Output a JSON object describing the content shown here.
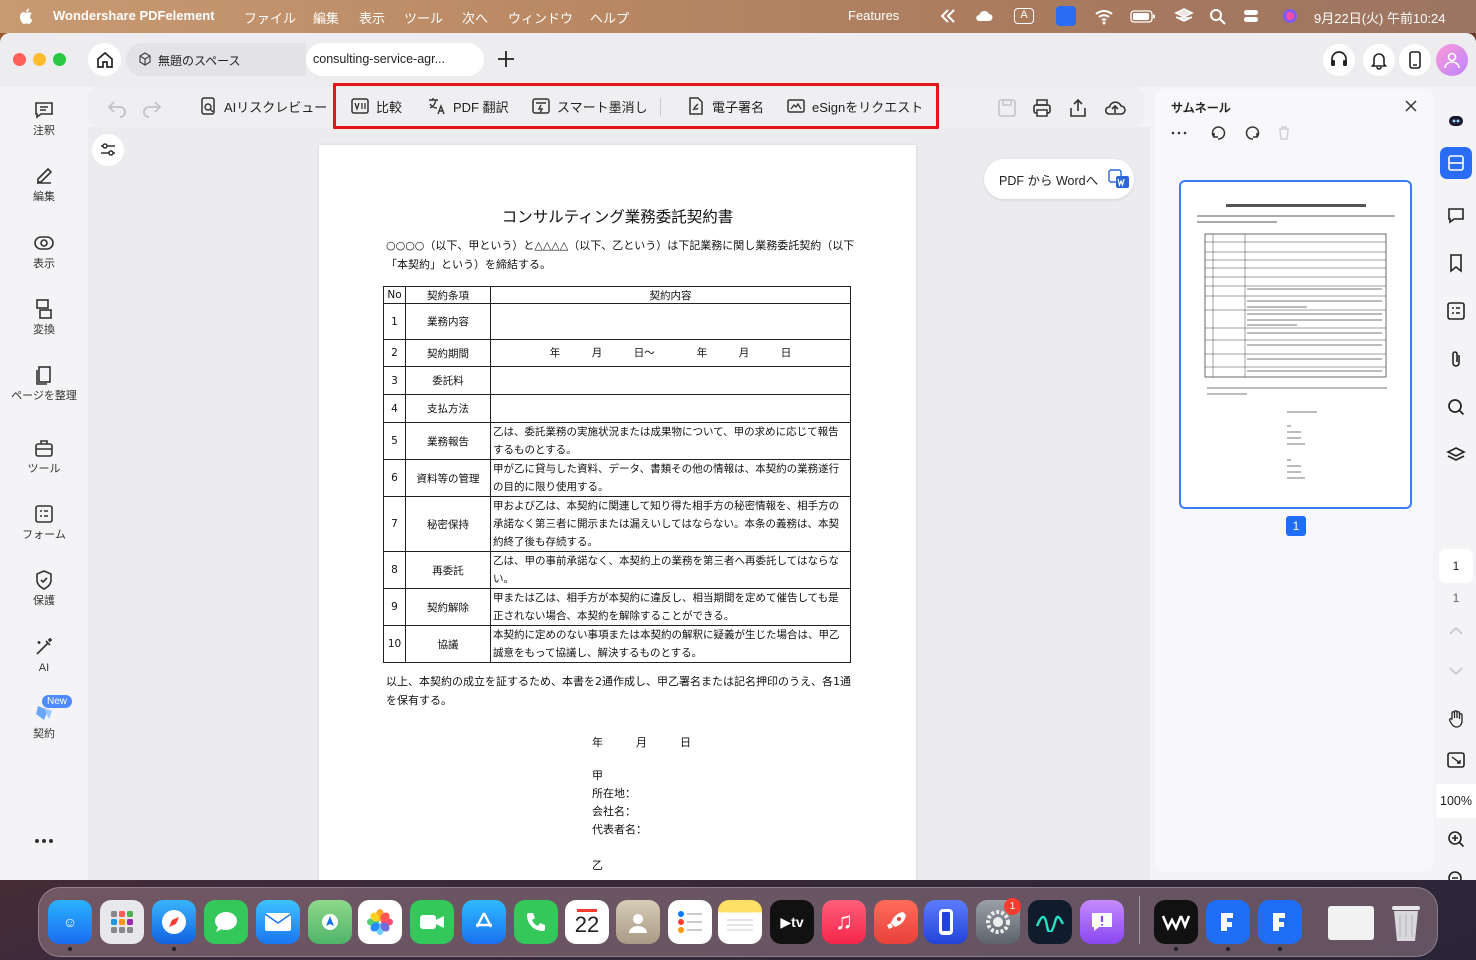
{
  "menubar": {
    "app_name": "Wondershare PDFelement",
    "menus": [
      "ファイル",
      "編集",
      "表示",
      "ツール",
      "次へ",
      "ウィンドウ",
      "ヘルプ"
    ],
    "features": "Features",
    "clock": "9月22日(火) 午前10:24",
    "input_indicator": "A"
  },
  "tabs": {
    "space": "無題のスペース",
    "document": "consulting-service-agr..."
  },
  "leftnav": [
    {
      "label": "注釈",
      "icon": "comment-icon"
    },
    {
      "label": "編集",
      "icon": "edit-icon"
    },
    {
      "label": "表示",
      "icon": "view-icon"
    },
    {
      "label": "変換",
      "icon": "convert-icon"
    },
    {
      "label": "ページを整理",
      "icon": "organize-pages-icon"
    },
    {
      "label": "ツール",
      "icon": "tools-icon"
    },
    {
      "label": "フォーム",
      "icon": "form-icon"
    },
    {
      "label": "保護",
      "icon": "protect-icon"
    },
    {
      "label": "AI",
      "icon": "ai-icon"
    },
    {
      "label": "契約",
      "icon": "contract-icon",
      "badge": "New"
    }
  ],
  "toolbar": {
    "ai_risk": "AIリスクレビュー",
    "compare": "比較",
    "translate": "PDF 翻訳",
    "redact": "スマート墨消し",
    "esign": "電子署名",
    "esign_request": "eSignをリクエスト"
  },
  "pdf_to_word": "PDF から Wordへ",
  "document": {
    "title": "コンサルティング業務委託契約書",
    "intro": "○○○○（以下、甲という）と△△△△（以下、乙という）は下記業務に関し業務委託契約（以下「本契約」という）を締結する。",
    "headers": [
      "No",
      "契約条項",
      "契約内容"
    ],
    "rows": [
      {
        "no": "1",
        "term": "業務内容",
        "content": ""
      },
      {
        "no": "2",
        "term": "契約期間",
        "content": "年　　　月　　　日〜　　　　年　　　月　　　日"
      },
      {
        "no": "3",
        "term": "委託料",
        "content": ""
      },
      {
        "no": "4",
        "term": "支払方法",
        "content": ""
      },
      {
        "no": "5",
        "term": "業務報告",
        "content": "乙は、委託業務の実施状況または成果物について、甲の求めに応じて報告するものとする。"
      },
      {
        "no": "6",
        "term": "資料等の管理",
        "content": "甲が乙に貸与した資料、データ、書類その他の情報は、本契約の業務遂行の目的に限り使用する。"
      },
      {
        "no": "7",
        "term": "秘密保持",
        "content": "甲および乙は、本契約に関連して知り得た相手方の秘密情報を、相手方の承諾なく第三者に開示または漏えいしてはならない。本条の義務は、本契約終了後も存続する。"
      },
      {
        "no": "8",
        "term": "再委託",
        "content": "乙は、甲の事前承諾なく、本契約上の業務を第三者へ再委託してはならない。"
      },
      {
        "no": "9",
        "term": "契約解除",
        "content": "甲または乙は、相手方が本契約に違反し、相当期間を定めて催告しても是正されない場合、本契約を解除することができる。"
      },
      {
        "no": "10",
        "term": "協議",
        "content": "本契約に定めのない事項または本契約の解釈に疑義が生じた場合は、甲乙誠意をもって協議し、解決するものとする。"
      }
    ],
    "closing": "以上、本契約の成立を証するため、本書を2通作成し、甲乙署名または記名押印のうえ、各1通を保有する。",
    "date_line": "年　　　月　　　日",
    "party_a": "甲",
    "address": "所在地：",
    "company": "会社名：",
    "representative": "代表者名：",
    "party_b": "乙"
  },
  "thumbnails": {
    "title": "サムネール",
    "page_number": "1"
  },
  "rightstrip": {
    "current_page": "1",
    "total_pages": "1",
    "zoom": "100%"
  },
  "dock": {
    "calendar_day": "22",
    "settings_badge": "1"
  }
}
